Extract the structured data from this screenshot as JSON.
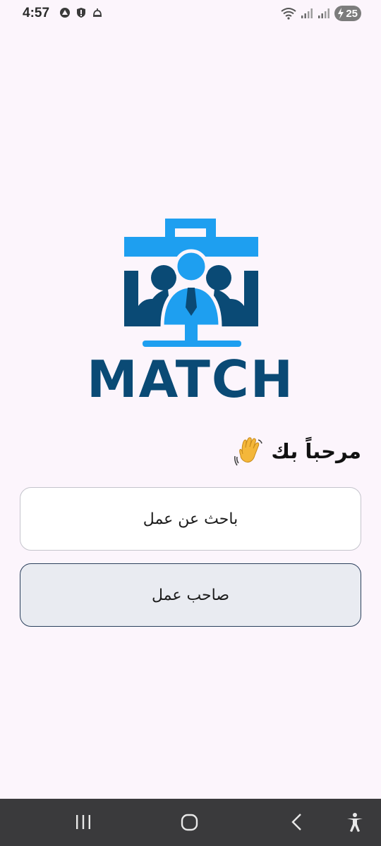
{
  "status_bar": {
    "time": "4:57",
    "battery_level": "25",
    "left_icons": [
      "notification-icon",
      "shield-icon",
      "bell-icon"
    ],
    "right_icons": [
      "wifi-icon",
      "signal-icon",
      "signal-icon"
    ]
  },
  "logo": {
    "brand_text": "MATCH",
    "colors": {
      "light_blue": "#1e9ff0",
      "dark_blue": "#0a4a75"
    }
  },
  "welcome": {
    "text": "مرحباً بك",
    "emoji_icon": "waving-hand-icon"
  },
  "buttons": {
    "job_seeker": "باحث عن عمل",
    "employer": "صاحب عمل"
  },
  "nav_bar": {
    "items": [
      "recent-apps-icon",
      "home-icon",
      "back-icon",
      "accessibility-icon"
    ]
  }
}
